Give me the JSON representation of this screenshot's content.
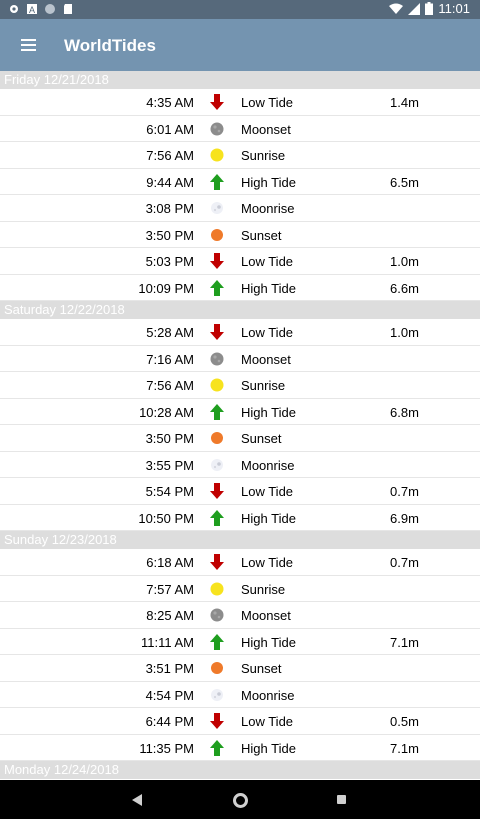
{
  "status": {
    "time": "11:01"
  },
  "app": {
    "title": "WorldTides"
  },
  "days": [
    {
      "header": "Friday 12/21/2018",
      "events": [
        {
          "time": "4:35 AM",
          "icon": "tide-low-arrow-icon",
          "label": "Low Tide",
          "height": "1.4m"
        },
        {
          "time": "6:01 AM",
          "icon": "moonset-icon",
          "label": "Moonset",
          "height": ""
        },
        {
          "time": "7:56 AM",
          "icon": "sunrise-icon",
          "label": "Sunrise",
          "height": ""
        },
        {
          "time": "9:44 AM",
          "icon": "tide-high-arrow-icon",
          "label": "High Tide",
          "height": "6.5m"
        },
        {
          "time": "3:08 PM",
          "icon": "moonrise-icon",
          "label": "Moonrise",
          "height": ""
        },
        {
          "time": "3:50 PM",
          "icon": "sunset-icon",
          "label": "Sunset",
          "height": ""
        },
        {
          "time": "5:03 PM",
          "icon": "tide-low-arrow-icon",
          "label": "Low Tide",
          "height": "1.0m"
        },
        {
          "time": "10:09 PM",
          "icon": "tide-high-arrow-icon",
          "label": "High Tide",
          "height": "6.6m"
        }
      ]
    },
    {
      "header": "Saturday 12/22/2018",
      "events": [
        {
          "time": "5:28 AM",
          "icon": "tide-low-arrow-icon",
          "label": "Low Tide",
          "height": "1.0m"
        },
        {
          "time": "7:16 AM",
          "icon": "moonset-icon",
          "label": "Moonset",
          "height": ""
        },
        {
          "time": "7:56 AM",
          "icon": "sunrise-icon",
          "label": "Sunrise",
          "height": ""
        },
        {
          "time": "10:28 AM",
          "icon": "tide-high-arrow-icon",
          "label": "High Tide",
          "height": "6.8m"
        },
        {
          "time": "3:50 PM",
          "icon": "sunset-icon",
          "label": "Sunset",
          "height": ""
        },
        {
          "time": "3:55 PM",
          "icon": "moonrise-icon",
          "label": "Moonrise",
          "height": ""
        },
        {
          "time": "5:54 PM",
          "icon": "tide-low-arrow-icon",
          "label": "Low Tide",
          "height": "0.7m"
        },
        {
          "time": "10:50 PM",
          "icon": "tide-high-arrow-icon",
          "label": "High Tide",
          "height": "6.9m"
        }
      ]
    },
    {
      "header": "Sunday 12/23/2018",
      "events": [
        {
          "time": "6:18 AM",
          "icon": "tide-low-arrow-icon",
          "label": "Low Tide",
          "height": "0.7m"
        },
        {
          "time": "7:57 AM",
          "icon": "sunrise-icon",
          "label": "Sunrise",
          "height": ""
        },
        {
          "time": "8:25 AM",
          "icon": "moonset-icon",
          "label": "Moonset",
          "height": ""
        },
        {
          "time": "11:11 AM",
          "icon": "tide-high-arrow-icon",
          "label": "High Tide",
          "height": "7.1m"
        },
        {
          "time": "3:51 PM",
          "icon": "sunset-icon",
          "label": "Sunset",
          "height": ""
        },
        {
          "time": "4:54 PM",
          "icon": "moonrise-icon",
          "label": "Moonrise",
          "height": ""
        },
        {
          "time": "6:44 PM",
          "icon": "tide-low-arrow-icon",
          "label": "Low Tide",
          "height": "0.5m"
        },
        {
          "time": "11:35 PM",
          "icon": "tide-high-arrow-icon",
          "label": "High Tide",
          "height": "7.1m"
        }
      ]
    },
    {
      "header": "Monday 12/24/2018",
      "events": []
    }
  ],
  "colors": {
    "appbar": "#7494b0",
    "statusbar": "#56697b",
    "low_tide": "#c00000",
    "high_tide": "#1f9e1f",
    "sun": "#f7e31e",
    "sunset": "#ef7a2a"
  }
}
